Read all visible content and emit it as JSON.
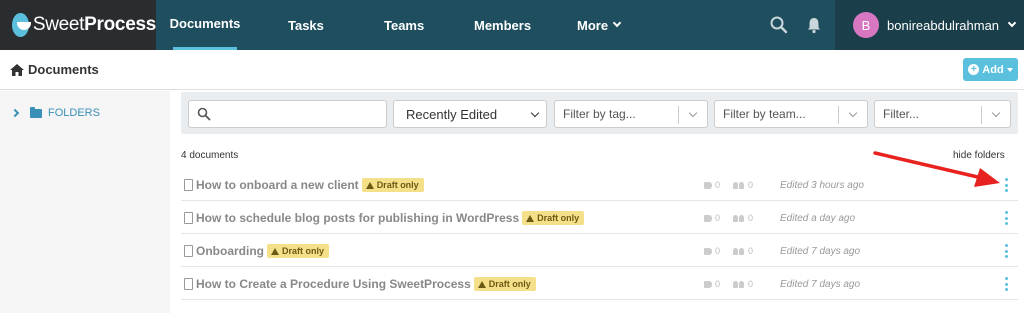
{
  "brand": {
    "name_light": "Sweet",
    "name_bold": "Process"
  },
  "nav": {
    "documents": "Documents",
    "tasks": "Tasks",
    "teams": "Teams",
    "members": "Members",
    "more": "More"
  },
  "toolbar_icons": [
    "search-icon",
    "bell-icon"
  ],
  "user": {
    "initial": "B",
    "username": "bonireabdulrahman"
  },
  "breadcrumb": {
    "label": "Documents"
  },
  "add_button": {
    "label": "Add"
  },
  "sidebar": {
    "folders_label": "FOLDERS"
  },
  "filters": {
    "search_placeholder": "",
    "sort_value": "Recently Edited",
    "tag_placeholder": "Filter by tag...",
    "team_placeholder": "Filter by team...",
    "other_placeholder": "Filter..."
  },
  "list": {
    "count_label": "4 documents",
    "hide_folders": "hide folders",
    "draft_label": "Draft only",
    "rows": [
      {
        "title": "How to onboard a new client",
        "tags": "0",
        "members": "0",
        "edited": "Edited 3 hours ago",
        "icon": "multi-document-icon"
      },
      {
        "title": "How to schedule blog posts for publishing in WordPress",
        "tags": "0",
        "members": "0",
        "edited": "Edited a day ago",
        "icon": "document-icon"
      },
      {
        "title": "Onboarding",
        "tags": "0",
        "members": "0",
        "edited": "Edited 7 days ago",
        "icon": "multi-document-icon"
      },
      {
        "title": "How to Create a Procedure Using SweetProcess",
        "tags": "0",
        "members": "0",
        "edited": "Edited 7 days ago",
        "icon": "document-icon"
      }
    ]
  },
  "colors": {
    "topbar": "#1f4f5e",
    "accent": "#5bc0de",
    "draft_badge": "#f5e08a",
    "annotation_arrow": "#e8231f"
  }
}
